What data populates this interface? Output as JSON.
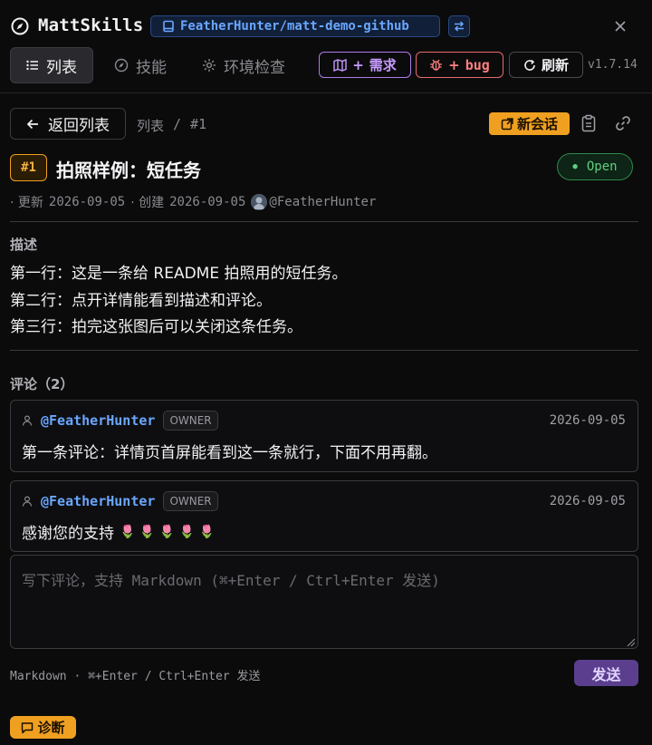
{
  "header": {
    "app_name": "MattSkills",
    "brand_icon": "compass-icon",
    "repo": "FeatherHunter/matt-demo-github",
    "repo_icon": "repo-icon",
    "swap_icon": "swap-icon",
    "close_icon": "close-icon"
  },
  "tabs": [
    {
      "label": "列表",
      "icon": "list-icon",
      "active": true
    },
    {
      "label": "技能",
      "icon": "compass-icon",
      "active": false
    },
    {
      "label": "环境检查",
      "icon": "gear-icon",
      "active": false
    }
  ],
  "actions": {
    "requirement_label": "需求",
    "requirement_prefix": "+",
    "bug_label": "bug",
    "bug_prefix": "+",
    "refresh_label": "刷新",
    "version": "v1.7.14"
  },
  "colors": {
    "accent_orange": "#f0a020",
    "link_blue": "#6aa6ff",
    "requirement_purple": "#c79bff",
    "bug_red": "#ff8080",
    "open_green": "#5fd07e"
  },
  "breadcrumb": {
    "back_label": "返回列表",
    "root": "列表",
    "separator": "/",
    "current": "#1",
    "new_session_label": "新会话"
  },
  "issue": {
    "number": "#1",
    "title": "拍照样例：短任务",
    "status": "Open",
    "meta_updated_label": "· 更新",
    "updated": "2026-09-05",
    "meta_created_label": "· 创建",
    "created": "2026-09-05",
    "author": "@FeatherHunter"
  },
  "description": {
    "label": "描述",
    "lines": [
      "第一行：这是一条给 README 拍照用的短任务。",
      "第二行：点开详情能看到描述和评论。",
      "第三行：拍完这张图后可以关闭这条任务。"
    ]
  },
  "comments": {
    "label": "评论（2）",
    "items": [
      {
        "author": "@FeatherHunter",
        "role": "OWNER",
        "date": "2026-09-05",
        "body": "第一条评论：详情页首屏能看到这一条就行，下面不用再翻。",
        "emoji": ""
      },
      {
        "author": "@FeatherHunter",
        "role": "OWNER",
        "date": "2026-09-05",
        "body": "感谢您的支持",
        "emoji": "🌷 🌷 🌷 🌷 🌷"
      }
    ]
  },
  "composer": {
    "placeholder": "写下评论，支持 Markdown (⌘+Enter / Ctrl+Enter 发送)",
    "value": "",
    "hint": "Markdown · ⌘+Enter / Ctrl+Enter 发送",
    "send_label": "发送"
  },
  "footer": {
    "diagnose_label": "诊断"
  }
}
